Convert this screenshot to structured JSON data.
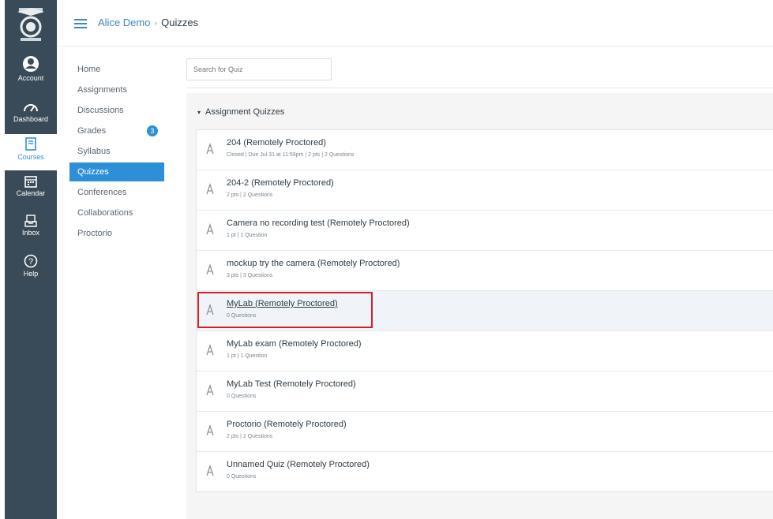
{
  "global_nav": {
    "items": [
      {
        "label": "Account",
        "icon": "user-circle-icon"
      },
      {
        "label": "Dashboard",
        "icon": "dashboard-icon"
      },
      {
        "label": "Courses",
        "icon": "courses-icon",
        "active": true
      },
      {
        "label": "Calendar",
        "icon": "calendar-icon"
      },
      {
        "label": "Inbox",
        "icon": "inbox-icon"
      },
      {
        "label": "Help",
        "icon": "help-icon"
      }
    ]
  },
  "header": {
    "course": "Alice Demo",
    "separator": "›",
    "page": "Quizzes"
  },
  "course_nav": {
    "items": [
      {
        "label": "Home"
      },
      {
        "label": "Assignments"
      },
      {
        "label": "Discussions"
      },
      {
        "label": "Grades",
        "badge": "3"
      },
      {
        "label": "Syllabus"
      },
      {
        "label": "Quizzes",
        "active": true
      },
      {
        "label": "Conferences"
      },
      {
        "label": "Collaborations"
      },
      {
        "label": "Proctorio"
      }
    ]
  },
  "search": {
    "placeholder": "Search for Quiz"
  },
  "group": {
    "caret": "▾",
    "title": "Assignment Quizzes"
  },
  "quizzes": [
    {
      "title": "204 (Remotely Proctored)",
      "meta": "Closed | Due Jul 31 at 11:59pm | 2 pts | 2 Questions"
    },
    {
      "title": "204-2 (Remotely Proctored)",
      "meta": "2 pts | 2 Questions"
    },
    {
      "title": "Camera no recording test (Remotely Proctored)",
      "meta": "1 pt | 1 Question"
    },
    {
      "title": "mockup try the camera (Remotely Proctored)",
      "meta": "3 pts | 3 Questions"
    },
    {
      "title": "MyLab (Remotely Proctored)",
      "meta": "0 Questions"
    },
    {
      "title": "MyLab exam (Remotely Proctored)",
      "meta": "1 pt | 1 Question"
    },
    {
      "title": "MyLab Test (Remotely Proctored)",
      "meta": "0 Questions"
    },
    {
      "title": "Proctorio (Remotely Proctored)",
      "meta": "2 pts | 2 Questions"
    },
    {
      "title": "Unnamed Quiz (Remotely Proctored)",
      "meta": "0 Questions"
    }
  ],
  "colors": {
    "nav_bg": "#394b58",
    "accent": "#2d8fd5",
    "highlight_box": "#d0202a"
  }
}
